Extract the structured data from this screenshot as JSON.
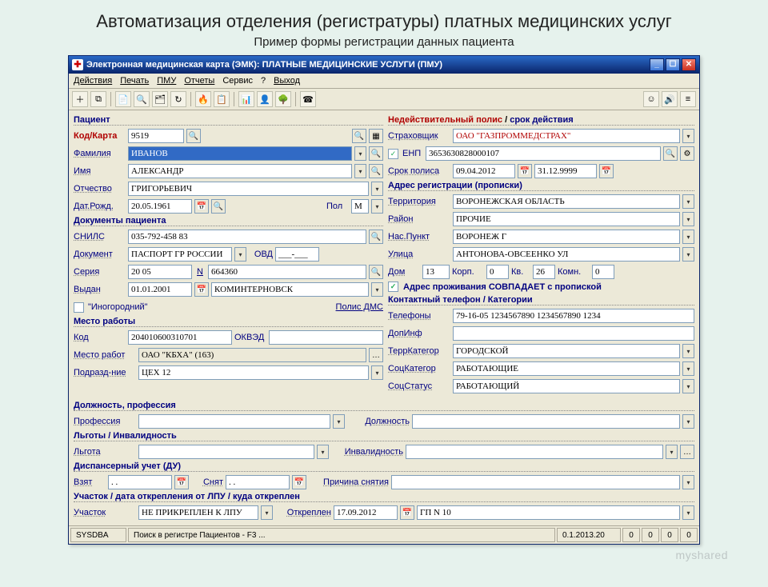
{
  "slide": {
    "title": "Автоматизация отделения (регистратуры) платных медицинских услуг",
    "subtitle": "Пример формы регистрации данных пациента"
  },
  "window": {
    "title": "Электронная медицинская карта (ЭМК): ПЛАТНЫЕ МЕДИЦИНСКИЕ УСЛУГИ (ПМУ)"
  },
  "menu": {
    "actions": "Действия",
    "print": "Печать",
    "pmu": "ПМУ",
    "reports": "Отчеты",
    "service": "Сервис",
    "help": "?",
    "exit": "Выход"
  },
  "patient": {
    "header": "Пациент",
    "kod_karta_label": "Код/Карта",
    "kod_karta_value": "9519",
    "surname_label": "Фамилия",
    "surname_value": "ИВАНОВ",
    "name_label": "Имя",
    "name_value": "АЛЕКСАНДР",
    "patronymic_label": "Отчество",
    "patronymic_value": "ГРИГОРЬЕВИЧ",
    "birthdate_label": "Дат.Рожд.",
    "birthdate_value": "20.05.1961",
    "sex_label": "Пол",
    "sex_value": "М"
  },
  "docs": {
    "header": "Документы пациента",
    "snils_label": "СНИЛС",
    "snils_value": "035-792-458 83",
    "doc_label": "Документ",
    "doc_value": "ПАСПОРТ ГР РОССИИ",
    "ovd_label": "ОВД",
    "ovd_value": "___-___",
    "series_label": "Серия",
    "series_value": "20 05",
    "n_label": "N",
    "n_value": "664360",
    "issued_label": "Выдан",
    "issued_date": "01.01.2001",
    "issued_by": "КОМИНТЕРНОВСК"
  },
  "dms": {
    "inogorodniy": "\"Иногородний\"",
    "polis_dms_label": "Полис ДМС"
  },
  "workplace": {
    "header": "Место работы",
    "kod_label": "Код",
    "kod_value": "204010600310701",
    "okved_label": "ОКВЭД",
    "okved_value": "",
    "place_label": "Место работ",
    "place_value": "ОАО \"КБХА\" (163)",
    "unit_label": "Подразд-ние",
    "unit_value": "ЦЕХ 12"
  },
  "position": {
    "header": "Должность, профессия",
    "prof_label": "Профессия",
    "pos_label": "Должность"
  },
  "benefits": {
    "header": "Льготы / Инвалидность",
    "lgota_label": "Льгота",
    "inv_label": "Инвалидность"
  },
  "dispanser": {
    "header": "Диспансерный учет (ДУ)",
    "taken_label": "Взят",
    "taken_value": ". .",
    "removed_label": "Снят",
    "removed_value": ". .",
    "reason_label": "Причина снятия"
  },
  "uchastok": {
    "header": "Участок / дата открепления от ЛПУ / куда откреплен",
    "label": "Участок",
    "value": "НЕ ПРИКРЕПЛЕН К ЛПУ",
    "otkrep_label": "Откреплен",
    "otkrep_date": "17.09.2012",
    "otkrep_where": "ГП N 10"
  },
  "policy": {
    "header_invalid": "Недействительный полис",
    "header_sep": " / ",
    "header_srok": "срок действия",
    "insurer_label": "Страховщик",
    "insurer_value": "ОАО \"ГАЗПРОММЕДСТРАХ\"",
    "enp_label": "ЕНП",
    "enp_value": "3653630828000107",
    "term_label": "Срок полиса",
    "term_from": "09.04.2012",
    "term_to": "31.12.9999"
  },
  "address": {
    "header": "Адрес регистрации (прописки)",
    "territory_label": "Территория",
    "territory_value": "ВОРОНЕЖСКАЯ ОБЛАСТЬ",
    "raion_label": "Район",
    "raion_value": "ПРОЧИЕ",
    "city_label": "Нас.Пункт",
    "city_value": "ВОРОНЕЖ Г",
    "street_label": "Улица",
    "street_value": "АНТОНОВА-ОВСЕЕНКО УЛ",
    "house_label": "Дом",
    "house_value": "13",
    "korp_label": "Корп.",
    "korp_value": "0",
    "kv_label": "Кв.",
    "kv_value": "26",
    "room_label": "Комн.",
    "room_value": "0",
    "match_label": "Адрес проживания СОВПАДАЕТ с пропиской"
  },
  "contacts": {
    "header": "Контактный телефон / Категории",
    "phone_label": "Телефоны",
    "phone_value": "79-16-05 1234567890 1234567890 1234",
    "dopinf_label": "ДопИнф",
    "terrkat_label": "ТеррКатегор",
    "terrkat_value": "ГОРОДСКОЙ",
    "sockat_label": "СоцКатегор",
    "sockat_value": "РАБОТАЮЩИЕ",
    "socstat_label": "СоцСтатус",
    "socstat_value": "РАБОТАЮЩИЙ"
  },
  "status": {
    "user": "SYSDBA",
    "hint": "Поиск в регистре Пациентов - F3 ...",
    "ver": "0.1.2013.20",
    "n1": "0",
    "n2": "0",
    "n3": "0",
    "n4": "0"
  },
  "watermark": "myshared"
}
